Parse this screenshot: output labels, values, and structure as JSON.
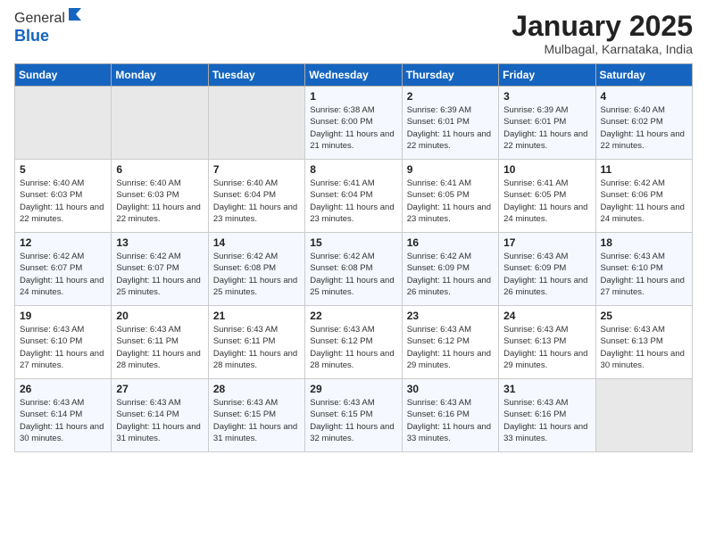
{
  "logo": {
    "general": "General",
    "blue": "Blue"
  },
  "title": "January 2025",
  "location": "Mulbagal, Karnataka, India",
  "days_of_week": [
    "Sunday",
    "Monday",
    "Tuesday",
    "Wednesday",
    "Thursday",
    "Friday",
    "Saturday"
  ],
  "weeks": [
    [
      {
        "day": "",
        "info": ""
      },
      {
        "day": "",
        "info": ""
      },
      {
        "day": "",
        "info": ""
      },
      {
        "day": "1",
        "info": "Sunrise: 6:38 AM\nSunset: 6:00 PM\nDaylight: 11 hours and 21 minutes."
      },
      {
        "day": "2",
        "info": "Sunrise: 6:39 AM\nSunset: 6:01 PM\nDaylight: 11 hours and 22 minutes."
      },
      {
        "day": "3",
        "info": "Sunrise: 6:39 AM\nSunset: 6:01 PM\nDaylight: 11 hours and 22 minutes."
      },
      {
        "day": "4",
        "info": "Sunrise: 6:40 AM\nSunset: 6:02 PM\nDaylight: 11 hours and 22 minutes."
      }
    ],
    [
      {
        "day": "5",
        "info": "Sunrise: 6:40 AM\nSunset: 6:03 PM\nDaylight: 11 hours and 22 minutes."
      },
      {
        "day": "6",
        "info": "Sunrise: 6:40 AM\nSunset: 6:03 PM\nDaylight: 11 hours and 22 minutes."
      },
      {
        "day": "7",
        "info": "Sunrise: 6:40 AM\nSunset: 6:04 PM\nDaylight: 11 hours and 23 minutes."
      },
      {
        "day": "8",
        "info": "Sunrise: 6:41 AM\nSunset: 6:04 PM\nDaylight: 11 hours and 23 minutes."
      },
      {
        "day": "9",
        "info": "Sunrise: 6:41 AM\nSunset: 6:05 PM\nDaylight: 11 hours and 23 minutes."
      },
      {
        "day": "10",
        "info": "Sunrise: 6:41 AM\nSunset: 6:05 PM\nDaylight: 11 hours and 24 minutes."
      },
      {
        "day": "11",
        "info": "Sunrise: 6:42 AM\nSunset: 6:06 PM\nDaylight: 11 hours and 24 minutes."
      }
    ],
    [
      {
        "day": "12",
        "info": "Sunrise: 6:42 AM\nSunset: 6:07 PM\nDaylight: 11 hours and 24 minutes."
      },
      {
        "day": "13",
        "info": "Sunrise: 6:42 AM\nSunset: 6:07 PM\nDaylight: 11 hours and 25 minutes."
      },
      {
        "day": "14",
        "info": "Sunrise: 6:42 AM\nSunset: 6:08 PM\nDaylight: 11 hours and 25 minutes."
      },
      {
        "day": "15",
        "info": "Sunrise: 6:42 AM\nSunset: 6:08 PM\nDaylight: 11 hours and 25 minutes."
      },
      {
        "day": "16",
        "info": "Sunrise: 6:42 AM\nSunset: 6:09 PM\nDaylight: 11 hours and 26 minutes."
      },
      {
        "day": "17",
        "info": "Sunrise: 6:43 AM\nSunset: 6:09 PM\nDaylight: 11 hours and 26 minutes."
      },
      {
        "day": "18",
        "info": "Sunrise: 6:43 AM\nSunset: 6:10 PM\nDaylight: 11 hours and 27 minutes."
      }
    ],
    [
      {
        "day": "19",
        "info": "Sunrise: 6:43 AM\nSunset: 6:10 PM\nDaylight: 11 hours and 27 minutes."
      },
      {
        "day": "20",
        "info": "Sunrise: 6:43 AM\nSunset: 6:11 PM\nDaylight: 11 hours and 28 minutes."
      },
      {
        "day": "21",
        "info": "Sunrise: 6:43 AM\nSunset: 6:11 PM\nDaylight: 11 hours and 28 minutes."
      },
      {
        "day": "22",
        "info": "Sunrise: 6:43 AM\nSunset: 6:12 PM\nDaylight: 11 hours and 28 minutes."
      },
      {
        "day": "23",
        "info": "Sunrise: 6:43 AM\nSunset: 6:12 PM\nDaylight: 11 hours and 29 minutes."
      },
      {
        "day": "24",
        "info": "Sunrise: 6:43 AM\nSunset: 6:13 PM\nDaylight: 11 hours and 29 minutes."
      },
      {
        "day": "25",
        "info": "Sunrise: 6:43 AM\nSunset: 6:13 PM\nDaylight: 11 hours and 30 minutes."
      }
    ],
    [
      {
        "day": "26",
        "info": "Sunrise: 6:43 AM\nSunset: 6:14 PM\nDaylight: 11 hours and 30 minutes."
      },
      {
        "day": "27",
        "info": "Sunrise: 6:43 AM\nSunset: 6:14 PM\nDaylight: 11 hours and 31 minutes."
      },
      {
        "day": "28",
        "info": "Sunrise: 6:43 AM\nSunset: 6:15 PM\nDaylight: 11 hours and 31 minutes."
      },
      {
        "day": "29",
        "info": "Sunrise: 6:43 AM\nSunset: 6:15 PM\nDaylight: 11 hours and 32 minutes."
      },
      {
        "day": "30",
        "info": "Sunrise: 6:43 AM\nSunset: 6:16 PM\nDaylight: 11 hours and 33 minutes."
      },
      {
        "day": "31",
        "info": "Sunrise: 6:43 AM\nSunset: 6:16 PM\nDaylight: 11 hours and 33 minutes."
      },
      {
        "day": "",
        "info": ""
      }
    ]
  ]
}
